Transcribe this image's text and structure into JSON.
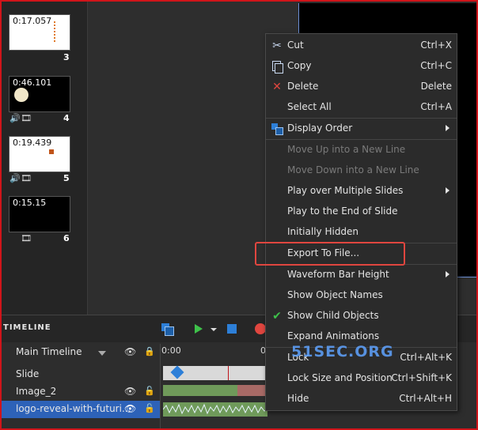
{
  "slides": [
    {
      "time": "0:17.057",
      "num": "3",
      "theme": "light",
      "icons": ""
    },
    {
      "time": "0:46.101",
      "num": "4",
      "theme": "dark",
      "icons": "speaker-film"
    },
    {
      "time": "0:19.439",
      "num": "5",
      "theme": "light",
      "icons": "speaker-film"
    },
    {
      "time": "0:15.15",
      "num": "6",
      "theme": "dark",
      "icons": "film"
    }
  ],
  "timeline": {
    "title": "TIMELINE",
    "main_label": "Main Timeline",
    "ruler_start": "0:00",
    "ruler_next": "0",
    "rows": [
      {
        "label": "Slide"
      },
      {
        "label": "Image_2"
      },
      {
        "label": "logo-reveal-with-futuri..."
      }
    ]
  },
  "menu": {
    "cut": {
      "label": "Cut",
      "shortcut": "Ctrl+X",
      "icon": "scissors-icon"
    },
    "copy": {
      "label": "Copy",
      "shortcut": "Ctrl+C",
      "icon": "copy-icon"
    },
    "delete": {
      "label": "Delete",
      "shortcut": "Delete",
      "icon": "delete-x-icon"
    },
    "select_all": {
      "label": "Select All",
      "shortcut": "Ctrl+A"
    },
    "display_order": {
      "label": "Display Order",
      "icon": "layers-icon"
    },
    "move_up": {
      "label": "Move Up into a New Line"
    },
    "move_down": {
      "label": "Move Down into a New Line"
    },
    "play_multiple": {
      "label": "Play over Multiple Slides"
    },
    "play_end": {
      "label": "Play to the End of Slide"
    },
    "initially_hidden": {
      "label": "Initially Hidden"
    },
    "export": {
      "label": "Export To File..."
    },
    "waveform": {
      "label": "Waveform Bar Height"
    },
    "show_names": {
      "label": "Show Object Names"
    },
    "show_child": {
      "label": "Show Child Objects",
      "icon": "checkmark-icon"
    },
    "expand": {
      "label": "Expand Animations"
    },
    "lock": {
      "label": "Lock",
      "shortcut": "Ctrl+Alt+K"
    },
    "lock_size": {
      "label": "Lock Size and Position",
      "shortcut": "Ctrl+Shift+K"
    },
    "hide": {
      "label": "Hide",
      "shortcut": "Ctrl+Alt+H"
    }
  },
  "watermark": "51SEC.ORG",
  "colors": {
    "accent": "#2d7fd8",
    "highlight": "#e0463f",
    "frame": "#d0141a"
  }
}
